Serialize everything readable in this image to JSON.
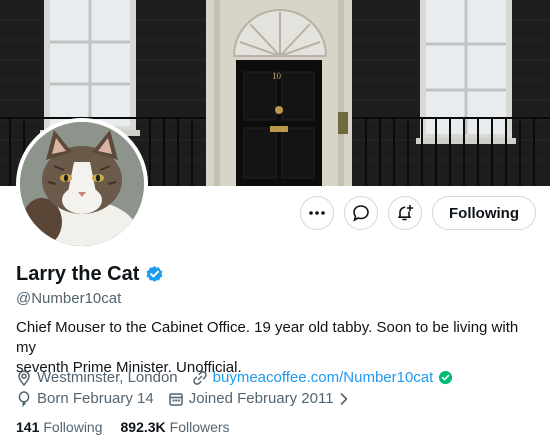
{
  "profile": {
    "display_name": "Larry the Cat",
    "handle": "@Number10cat",
    "bio_line1": "Chief Mouser to the Cabinet Office. 19 year old tabby. Soon to be living with my",
    "bio_line2": "seventh Prime Minister. Unofficial.",
    "location": "Westminster, London",
    "website": "buymeacoffee.com/Number10cat",
    "birthday": "Born February 14",
    "joined": "Joined February 2011",
    "following_count": "141",
    "following_label": "Following",
    "followers_count": "892.3K",
    "followers_label": "Followers"
  },
  "banner": {
    "door_number": "10"
  },
  "actions": {
    "follow_label": "Following"
  },
  "icons": {
    "more": "more-icon",
    "message": "message-icon",
    "notify": "notification-bell-icon",
    "verified": "verified-badge-icon",
    "location": "location-pin-icon",
    "link": "link-icon",
    "birthday": "balloon-icon",
    "calendar": "calendar-icon",
    "chevron": "chevron-right-icon"
  },
  "colors": {
    "accent": "#1d9bf0",
    "verified_green": "#00ba7c"
  }
}
